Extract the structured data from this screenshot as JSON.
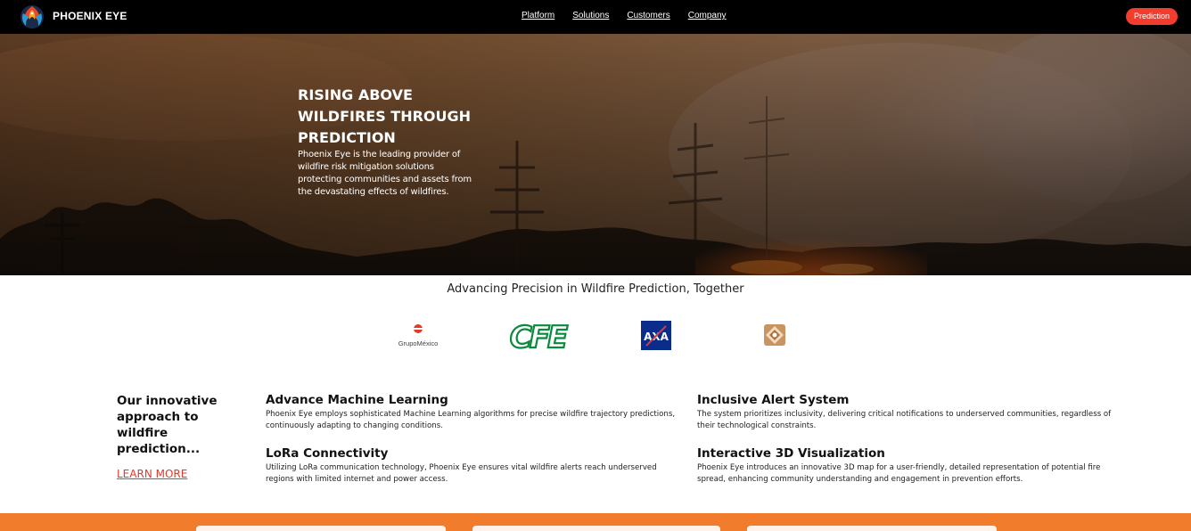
{
  "nav": {
    "brand": "PHOENIX EYE",
    "links": [
      "Platform",
      "Solutions",
      "Customers",
      "Company"
    ],
    "cta": "Prediction"
  },
  "hero": {
    "title": "RISING ABOVE WILDFIRES THROUGH PREDICTION",
    "description": "Phoenix Eye is the leading provider of wildfire risk mitigation solutions protecting communities and assets from the devastating effects of wildfires."
  },
  "partners": {
    "title": "Advancing Precision in Wildfire Prediction, Together",
    "logos": [
      "GrupoMéxico",
      "CFE",
      "AXA",
      "university-crest"
    ]
  },
  "approach": {
    "heading": "Our innovative approach to wildfire prediction...",
    "link": "LEARN MORE"
  },
  "features": [
    {
      "title": "Advance Machine Learning",
      "text": "Phoenix Eye employs sophisticated Machine Learning algorithms for precise wildfire trajectory predictions, continuously adapting to changing conditions."
    },
    {
      "title": "Inclusive Alert System",
      "text": "The system prioritizes inclusivity, delivering critical notifications to underserved communities, regardless of their technological constraints."
    },
    {
      "title": "LoRa Connectivity",
      "text": "Utilizing LoRa communication technology, Phoenix Eye ensures vital wildfire alerts reach underserved regions with limited internet and power access."
    },
    {
      "title": "Interactive 3D Visualization",
      "text": "Phoenix Eye introduces an innovative 3D map for a user-friendly, detailed representation of potential fire spread, enhancing community understanding and engagement in prevention efforts."
    }
  ],
  "colors": {
    "accent": "#f23d2e",
    "band": "#f07c2c",
    "cfe_green": "#0a8a3c",
    "axa_blue": "#0a2d8c",
    "link_red": "#e03a2a"
  }
}
